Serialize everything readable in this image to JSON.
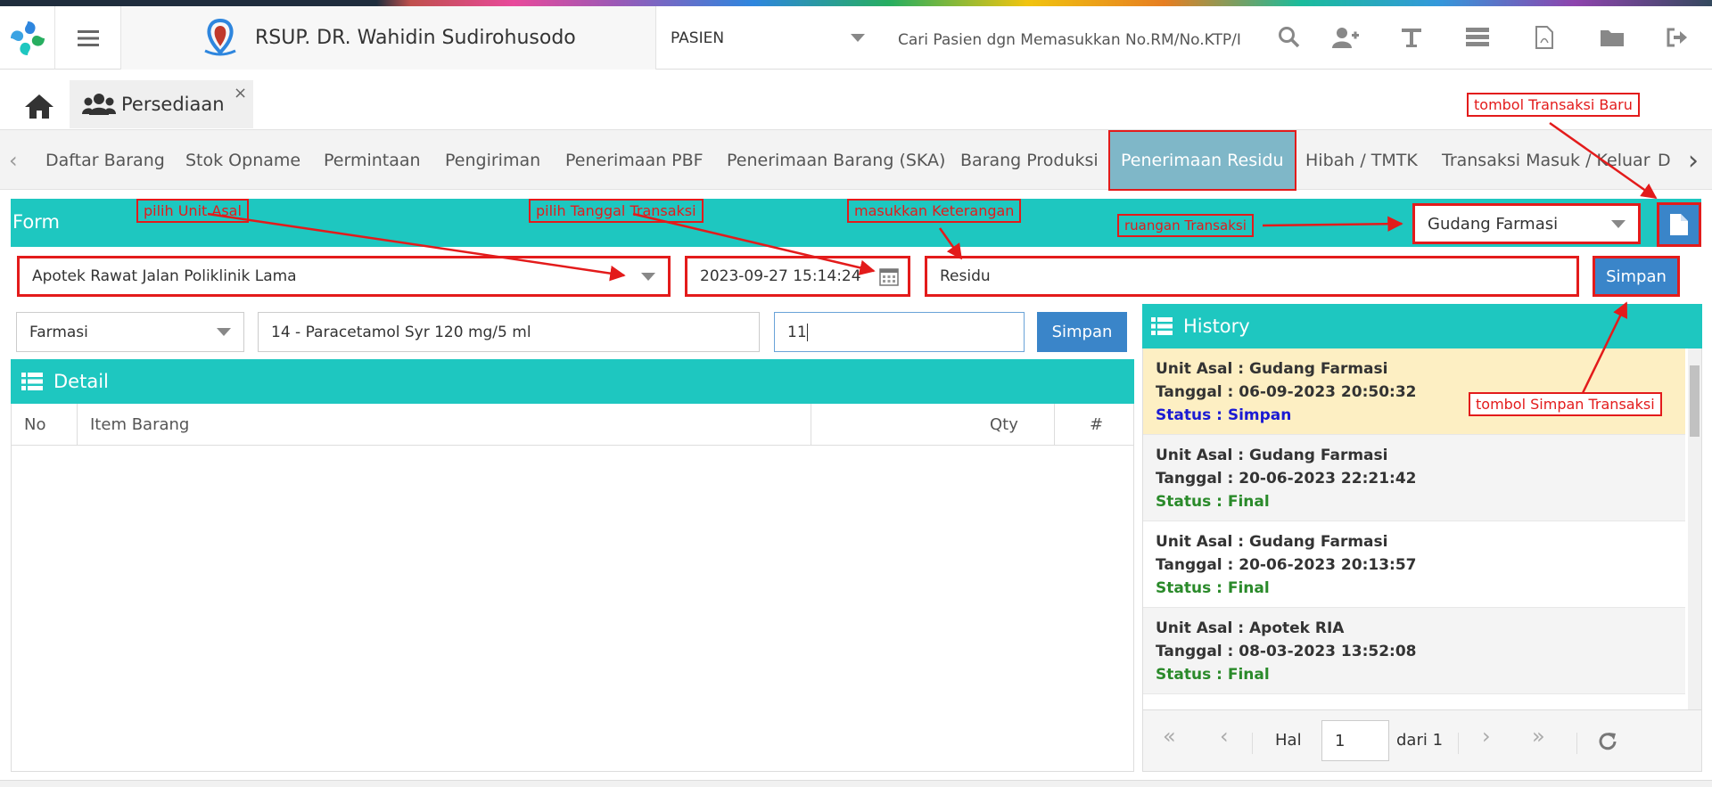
{
  "topbar": {
    "hospital_name": "RSUP. DR. Wahidin Sudirohusodo",
    "patient_type": "PASIEN",
    "search_placeholder": "Cari Pasien dgn Memasukkan No.RM/No.KTP/I"
  },
  "tab": {
    "label": "Persediaan",
    "close": "×"
  },
  "nav": {
    "items": [
      "Daftar Barang",
      "Stok Opname",
      "Permintaan",
      "Pengiriman",
      "Penerimaan PBF",
      "Penerimaan Barang (SKA)",
      "Barang Produksi",
      "Penerimaan Residu",
      "Hibah / TMTK",
      "Transaksi Masuk / Keluar",
      "D"
    ],
    "active": "Penerimaan Residu"
  },
  "form": {
    "title": "Form",
    "ruangan": "Gudang Farmasi",
    "unit_asal": "Apotek Rawat Jalan Poliklinik Lama",
    "tanggal": "2023-09-27 15:14:24",
    "keterangan": "Residu",
    "simpan_label": "Simpan"
  },
  "item_entry": {
    "kategori": "Farmasi",
    "barang": "14 - Paracetamol Syr 120 mg/5 ml",
    "qty": "11",
    "simpan_label": "Simpan"
  },
  "detail": {
    "title": "Detail",
    "columns": [
      "No",
      "Item Barang",
      "Qty",
      "#"
    ]
  },
  "history": {
    "title": "History",
    "items": [
      {
        "unit": "Unit Asal : Gudang Farmasi",
        "tanggal": "Tanggal : 06-09-2023 20:50:32",
        "status": "Status : Simpan"
      },
      {
        "unit": "Unit Asal : Gudang Farmasi",
        "tanggal": "Tanggal : 20-06-2023 22:21:42",
        "status": "Status : Final"
      },
      {
        "unit": "Unit Asal : Gudang Farmasi",
        "tanggal": "Tanggal : 20-06-2023 20:13:57",
        "status": "Status : Final"
      },
      {
        "unit": "Unit Asal : Apotek RIA",
        "tanggal": "Tanggal : 08-03-2023 13:52:08",
        "status": "Status : Final"
      }
    ]
  },
  "pager": {
    "hal_label": "Hal",
    "page": "1",
    "dari_label": "dari 1"
  },
  "annotations": {
    "unit_asal": "pilih Unit Asal",
    "tanggal": "pilih Tanggal Transaksi",
    "keterangan": "masukkan Keterangan",
    "ruangan": "ruangan Transaksi",
    "baru": "tombol Transaksi Baru",
    "simpan": "tombol Simpan Transaksi"
  },
  "colors": {
    "teal": "#1ec7c0",
    "primary_button": "#3a85c9",
    "annotation_red": "#e31b1b",
    "highlight_row": "#fdefc3"
  }
}
